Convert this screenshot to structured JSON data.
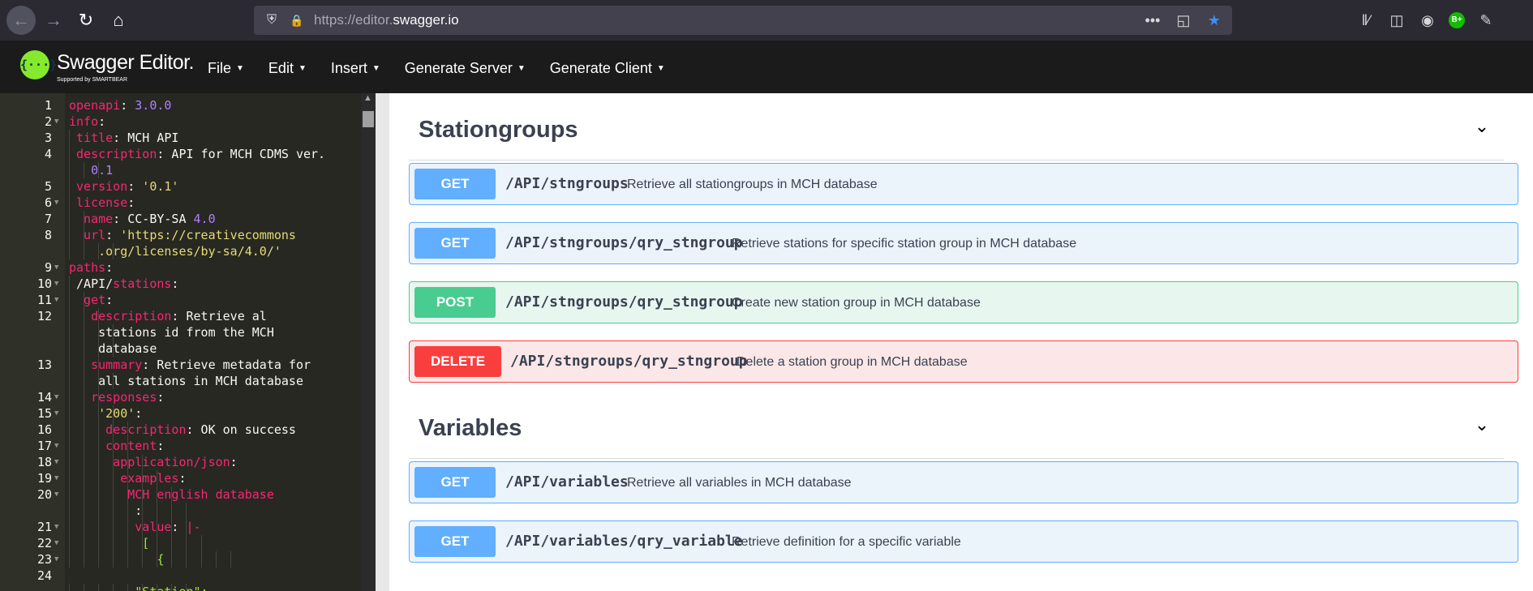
{
  "browser": {
    "url_prefix": "https://editor.",
    "url_domain": "swagger.io",
    "page_actions_glyph": "•••",
    "extension_badge": "B+"
  },
  "header": {
    "logo_glyph": "{···}",
    "app_title": "Swagger Editor.",
    "app_subtitle": "Supported by SMARTBEAR",
    "menu": [
      {
        "label": "File"
      },
      {
        "label": "Edit"
      },
      {
        "label": "Insert"
      },
      {
        "label": "Generate Server"
      },
      {
        "label": "Generate Client"
      }
    ]
  },
  "editor": {
    "lines": [
      {
        "num": "1",
        "fold": false,
        "indent": 0,
        "parts": [
          [
            "k",
            "openapi"
          ],
          [
            "p",
            ": "
          ],
          [
            "n",
            "3.0.0"
          ]
        ]
      },
      {
        "num": "2",
        "fold": true,
        "indent": 0,
        "parts": [
          [
            "k",
            "info"
          ],
          [
            "p",
            ":"
          ]
        ]
      },
      {
        "num": "3",
        "fold": false,
        "indent": 1,
        "parts": [
          [
            "k",
            "title"
          ],
          [
            "p",
            ": MCH API"
          ]
        ]
      },
      {
        "num": "4",
        "fold": false,
        "indent": 1,
        "parts": [
          [
            "k",
            "description"
          ],
          [
            "p",
            ": API for MCH CDMS ver."
          ]
        ]
      },
      {
        "num": "",
        "fold": false,
        "indent": 3,
        "parts": [
          [
            "n",
            "0.1"
          ]
        ]
      },
      {
        "num": "5",
        "fold": false,
        "indent": 1,
        "parts": [
          [
            "k",
            "version"
          ],
          [
            "p",
            ": "
          ],
          [
            "s",
            "'0.1'"
          ]
        ]
      },
      {
        "num": "6",
        "fold": true,
        "indent": 1,
        "parts": [
          [
            "k",
            "license"
          ],
          [
            "p",
            ":"
          ]
        ]
      },
      {
        "num": "7",
        "fold": false,
        "indent": 2,
        "parts": [
          [
            "k",
            "name"
          ],
          [
            "p",
            ": CC-BY-SA "
          ],
          [
            "n",
            "4.0"
          ]
        ]
      },
      {
        "num": "8",
        "fold": false,
        "indent": 2,
        "parts": [
          [
            "k",
            "url"
          ],
          [
            "p",
            ": "
          ],
          [
            "s",
            "'https://creativecommons"
          ]
        ]
      },
      {
        "num": "",
        "fold": false,
        "indent": 4,
        "parts": [
          [
            "s",
            ".org/licenses/by-sa/4.0/'"
          ]
        ]
      },
      {
        "num": "9",
        "fold": true,
        "indent": 0,
        "parts": [
          [
            "k",
            "paths"
          ],
          [
            "p",
            ":"
          ]
        ]
      },
      {
        "num": "10",
        "fold": true,
        "indent": 1,
        "parts": [
          [
            "p",
            "/API/"
          ],
          [
            "k",
            "stations"
          ],
          [
            "p",
            ":"
          ]
        ]
      },
      {
        "num": "11",
        "fold": true,
        "indent": 2,
        "parts": [
          [
            "k",
            "get"
          ],
          [
            "p",
            ":"
          ]
        ]
      },
      {
        "num": "12",
        "fold": false,
        "indent": 3,
        "parts": [
          [
            "k",
            "description"
          ],
          [
            "p",
            ": Retrieve al"
          ]
        ]
      },
      {
        "num": "",
        "fold": false,
        "indent": 4,
        "parts": [
          [
            "p",
            "stations id from the MCH"
          ]
        ]
      },
      {
        "num": "",
        "fold": false,
        "indent": 4,
        "parts": [
          [
            "p",
            "database"
          ]
        ]
      },
      {
        "num": "13",
        "fold": false,
        "indent": 3,
        "parts": [
          [
            "k",
            "summary"
          ],
          [
            "p",
            ": Retrieve metadata for"
          ]
        ]
      },
      {
        "num": "",
        "fold": false,
        "indent": 4,
        "parts": [
          [
            "p",
            "all stations in MCH database"
          ]
        ]
      },
      {
        "num": "14",
        "fold": true,
        "indent": 3,
        "parts": [
          [
            "k",
            "responses"
          ],
          [
            "p",
            ":"
          ]
        ]
      },
      {
        "num": "15",
        "fold": true,
        "indent": 4,
        "parts": [
          [
            "s",
            "'200'"
          ],
          [
            "p",
            ":"
          ]
        ]
      },
      {
        "num": "16",
        "fold": false,
        "indent": 5,
        "parts": [
          [
            "k",
            "description"
          ],
          [
            "p",
            ": OK on success"
          ]
        ]
      },
      {
        "num": "17",
        "fold": true,
        "indent": 5,
        "parts": [
          [
            "k",
            "content"
          ],
          [
            "p",
            ":"
          ]
        ]
      },
      {
        "num": "18",
        "fold": true,
        "indent": 6,
        "parts": [
          [
            "k",
            "application/json"
          ],
          [
            "p",
            ":"
          ]
        ]
      },
      {
        "num": "19",
        "fold": true,
        "indent": 7,
        "parts": [
          [
            "k",
            "examples"
          ],
          [
            "p",
            ":"
          ]
        ]
      },
      {
        "num": "20",
        "fold": true,
        "indent": 8,
        "parts": [
          [
            "k",
            "MCH english database"
          ]
        ]
      },
      {
        "num": "",
        "fold": false,
        "indent": 9,
        "parts": [
          [
            "p",
            ":"
          ]
        ]
      },
      {
        "num": "21",
        "fold": true,
        "indent": 9,
        "parts": [
          [
            "k",
            "value"
          ],
          [
            "p",
            ": "
          ],
          [
            "k",
            "|-"
          ]
        ]
      },
      {
        "num": "22",
        "fold": true,
        "indent": 10,
        "parts": [
          [
            "g",
            "["
          ]
        ]
      },
      {
        "num": "23",
        "fold": true,
        "indent": 12,
        "parts": [
          [
            "g",
            "{"
          ]
        ]
      },
      {
        "num": "24",
        "fold": false,
        "indent": 0,
        "parts": [
          [
            "p",
            ""
          ]
        ]
      },
      {
        "num": "",
        "fold": false,
        "indent": 9,
        "parts": [
          [
            "g",
            "\"Station\":"
          ]
        ]
      }
    ]
  },
  "ui": {
    "sections": [
      {
        "title": "Stationgroups",
        "operations": [
          {
            "method": "GET",
            "type": "get",
            "path": "/API/stngroups",
            "summary": "Retrieve all stationgroups in MCH database"
          },
          {
            "method": "GET",
            "type": "get",
            "path": "/API/stngroups/qry_stngroup",
            "summary": "Retrieve stations for specific station group in MCH database"
          },
          {
            "method": "POST",
            "type": "post",
            "path": "/API/stngroups/qry_stngroup",
            "summary": "Create new station group in MCH database"
          },
          {
            "method": "DELETE",
            "type": "delete",
            "path": "/API/stngroups/qry_stngroup",
            "summary": "Delete a station group in MCH database"
          }
        ]
      },
      {
        "title": "Variables",
        "operations": [
          {
            "method": "GET",
            "type": "get",
            "path": "/API/variables",
            "summary": "Retrieve all variables in MCH database"
          },
          {
            "method": "GET",
            "type": "get",
            "path": "/API/variables/qry_variable",
            "summary": "Retrieve definition for a specific variable"
          }
        ]
      }
    ]
  },
  "colors": {
    "get": "#61affe",
    "post": "#49cc90",
    "delete": "#f93e3e",
    "header_bg": "#1b1b1b",
    "editor_bg": "#272822"
  }
}
